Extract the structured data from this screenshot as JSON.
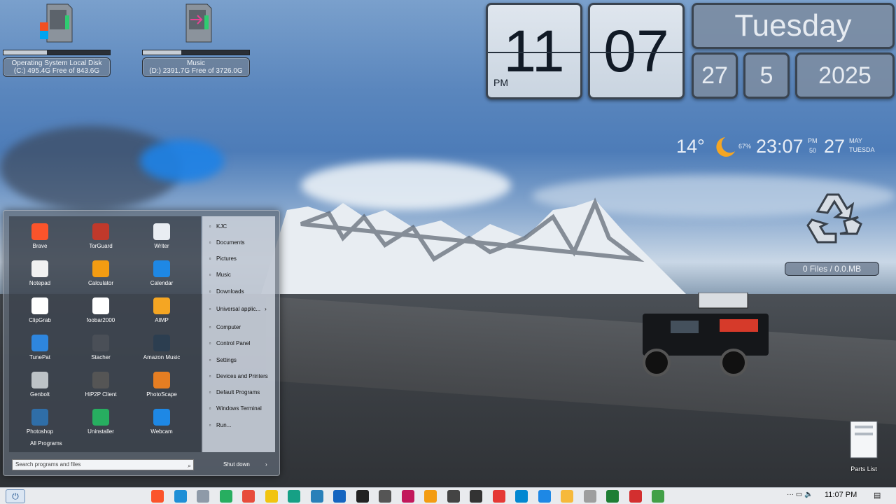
{
  "drives": [
    {
      "name": "Operating System Local Disk",
      "detail": "(C:) 495.4G Free of 843.6G",
      "used_fraction": 0.41
    },
    {
      "name": "Music",
      "detail": "(D:) 2391.7G Free of 3726.0G",
      "used_fraction": 0.36
    }
  ],
  "clock": {
    "hour": "11",
    "minute": "07",
    "ampm": "PM",
    "weekday": "Tuesday",
    "day": "27",
    "month": "5",
    "year": "2025"
  },
  "weather": {
    "temp": "14°",
    "humidity": "67%",
    "time": "23:07",
    "ampm": "PM",
    "seconds": "50",
    "day": "27",
    "month": "MAY",
    "weekday": "TUESDA"
  },
  "recycle_bin": {
    "status": "0 Files / 0.0.MB"
  },
  "desktop_icons": {
    "parts_list": "Parts List"
  },
  "start_menu": {
    "apps": [
      {
        "label": "Brave",
        "icon": "brave-icon",
        "color": "#fb542b"
      },
      {
        "label": "TorGuard",
        "icon": "vpn-shield-icon",
        "color": "#c0392b"
      },
      {
        "label": "Writer",
        "icon": "document-icon",
        "color": "#e9edf2"
      },
      {
        "label": "Notepad",
        "icon": "notepad-icon",
        "color": "#f1f1f1"
      },
      {
        "label": "Calculator",
        "icon": "calculator-icon",
        "color": "#f39c12"
      },
      {
        "label": "Calendar",
        "icon": "calendar-icon",
        "color": "#1e88e5"
      },
      {
        "label": "ClipGrab",
        "icon": "clipgrab-icon",
        "color": "#ffffff"
      },
      {
        "label": "foobar2000",
        "icon": "foobar-icon",
        "color": "#ffffff"
      },
      {
        "label": "AIMP",
        "icon": "headphones-icon",
        "color": "#f5a623"
      },
      {
        "label": "TunePat",
        "icon": "music-note-icon",
        "color": "#2e86de"
      },
      {
        "label": "Stacher",
        "icon": "video-icon",
        "color": "#4a4f57"
      },
      {
        "label": "Amazon Music",
        "icon": "amazon-music-icon",
        "color": "#2c3e50"
      },
      {
        "label": "Genbolt",
        "icon": "camera-icon",
        "color": "#bdc3c7"
      },
      {
        "label": "HiP2P Client",
        "icon": "webcam-icon",
        "color": "#555555"
      },
      {
        "label": "PhotoScape",
        "icon": "photoscape-icon",
        "color": "#e67e22"
      },
      {
        "label": "Photoshop",
        "icon": "photoshop-icon",
        "color": "#2f6ea8"
      },
      {
        "label": "Uninstaller",
        "icon": "recycle-icon",
        "color": "#27ae60"
      },
      {
        "label": "Webcam",
        "icon": "upload-icon",
        "color": "#1e88e5"
      }
    ],
    "all_programs": "All Programs",
    "places": [
      {
        "label": "KJC",
        "icon": "user-icon"
      },
      {
        "label": "Documents",
        "icon": "documents-icon"
      },
      {
        "label": "Pictures",
        "icon": "pictures-icon"
      },
      {
        "label": "Music",
        "icon": "music-icon"
      },
      {
        "label": "Downloads",
        "icon": "downloads-icon"
      },
      {
        "label": "Universal applic...",
        "icon": "apps-icon"
      },
      {
        "label": "Computer",
        "icon": "computer-icon"
      },
      {
        "label": "Control Panel",
        "icon": "control-panel-icon"
      },
      {
        "label": "Settings",
        "icon": "gear-icon"
      },
      {
        "label": "Devices and Printers",
        "icon": "printer-icon"
      },
      {
        "label": "Default Programs",
        "icon": "default-programs-icon"
      },
      {
        "label": "Windows Terminal",
        "icon": "terminal-icon"
      },
      {
        "label": "Run...",
        "icon": "run-icon"
      }
    ],
    "search_placeholder": "Search programs and files",
    "shutdown_label": "Shut down"
  },
  "taskbar": {
    "time": "11:07 PM",
    "apps": [
      {
        "icon": "brave-icon",
        "color": "#fb542b"
      },
      {
        "icon": "edge-icon",
        "color": "#1f8fd6"
      },
      {
        "icon": "calculator-icon",
        "color": "#8e9aa8"
      },
      {
        "icon": "network-icon",
        "color": "#27ae60"
      },
      {
        "icon": "color-picker-icon",
        "color": "#e74c3c"
      },
      {
        "icon": "paint-icon",
        "color": "#f1c40f"
      },
      {
        "icon": "sync-icon",
        "color": "#16a085"
      },
      {
        "icon": "cursor-icon",
        "color": "#2980b9"
      },
      {
        "icon": "malwarebytes-icon",
        "color": "#1565c0"
      },
      {
        "icon": "p-app-icon",
        "color": "#222222"
      },
      {
        "icon": "camera-icon",
        "color": "#555555"
      },
      {
        "icon": "media-icon",
        "color": "#c2185b"
      },
      {
        "icon": "water-drop-icon",
        "color": "#f39c12"
      },
      {
        "icon": "steam-icon",
        "color": "#444444"
      },
      {
        "icon": "foobar-icon",
        "color": "#333333"
      },
      {
        "icon": "flipboard-icon",
        "color": "#e53935"
      },
      {
        "icon": "snip-icon",
        "color": "#0288d1"
      },
      {
        "icon": "upload-icon",
        "color": "#1e88e5"
      },
      {
        "icon": "weather-icon",
        "color": "#f6b93b"
      },
      {
        "icon": "cloud-icon",
        "color": "#9e9e9e"
      },
      {
        "icon": "excel-icon",
        "color": "#1e7e34"
      },
      {
        "icon": "record-icon",
        "color": "#d32f2f"
      },
      {
        "icon": "bluestacks-icon",
        "color": "#43a047"
      }
    ]
  }
}
